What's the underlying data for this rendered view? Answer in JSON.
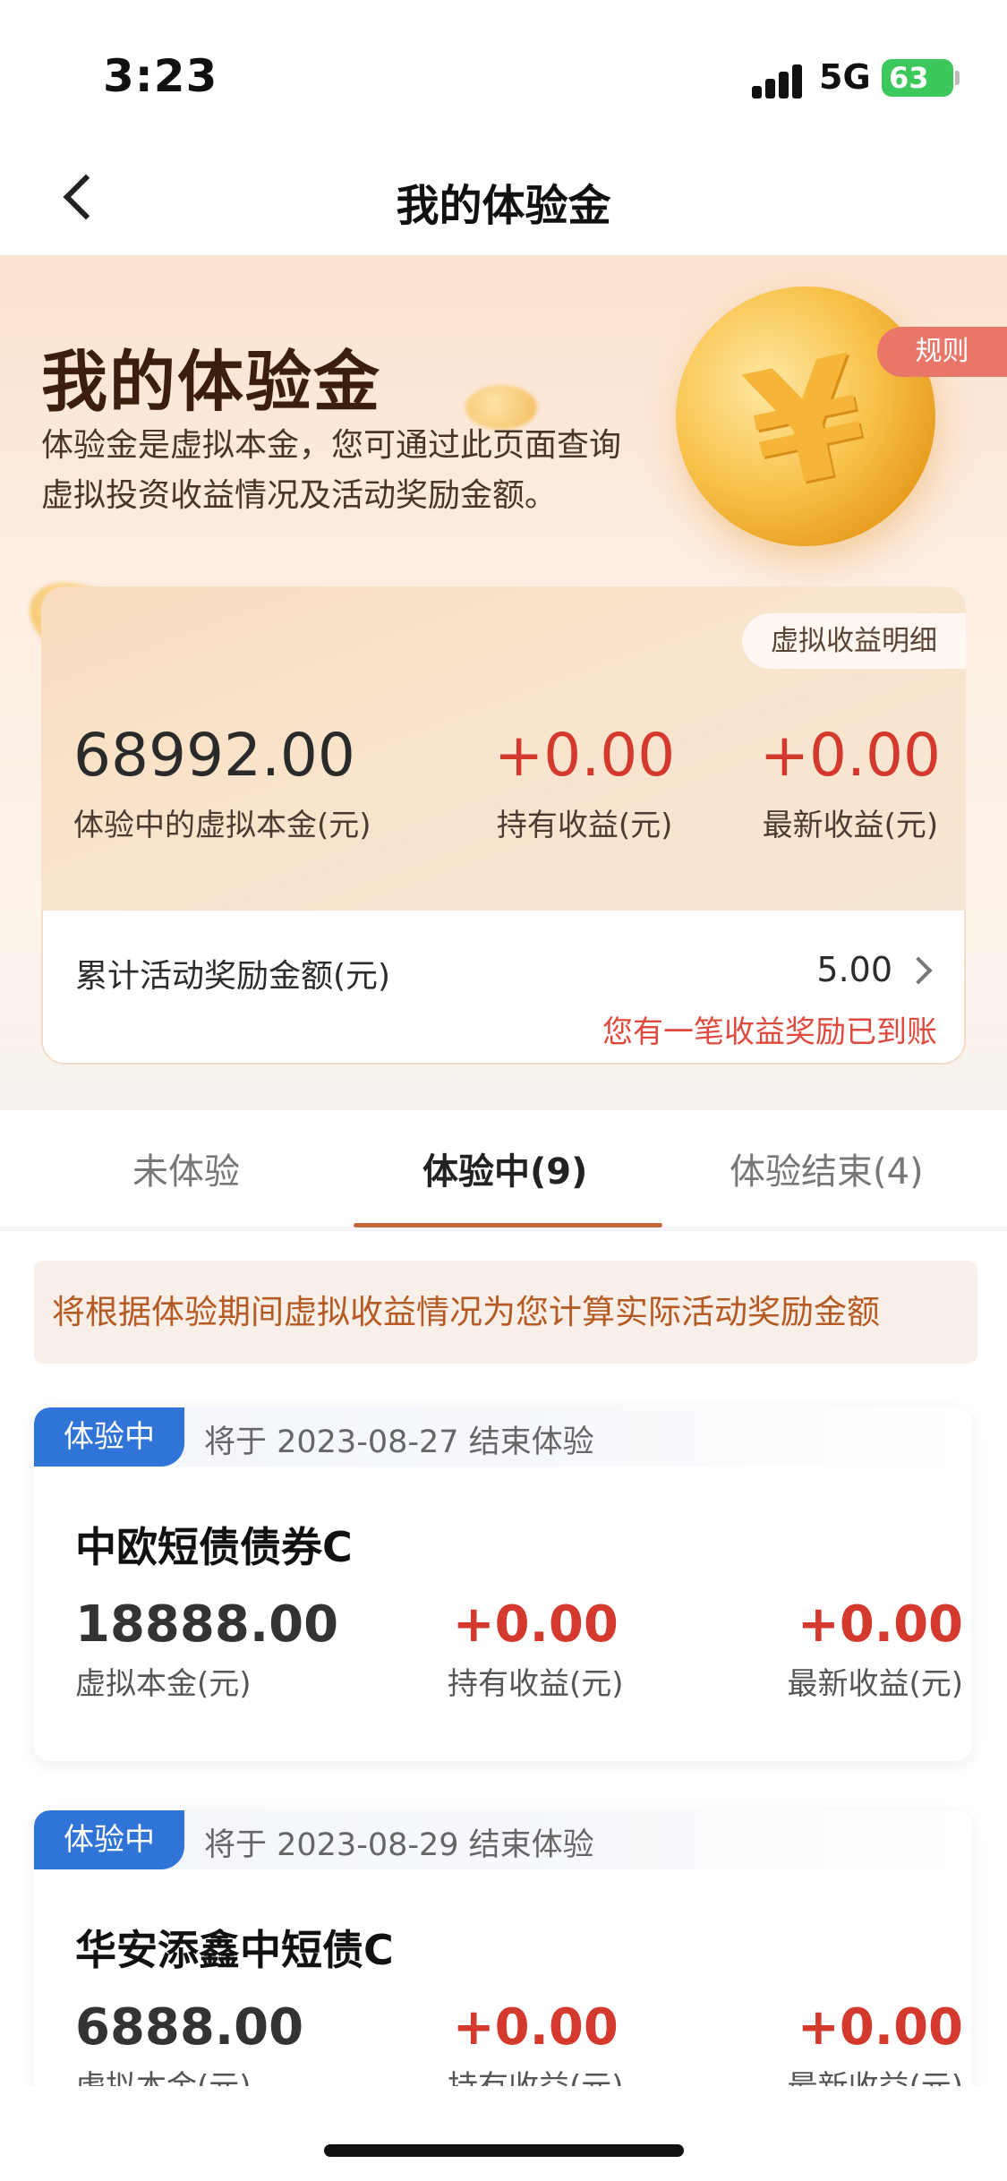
{
  "status_bar": {
    "time": "3:23",
    "network": "5G",
    "battery": "63"
  },
  "nav": {
    "title": "我的体验金"
  },
  "hero": {
    "title": "我的体验金",
    "description": "体验金是虚拟本金，您可通过此页面查询虚拟投资收益情况及活动奖励金额。",
    "rules_label": "规则"
  },
  "summary": {
    "detail_button": "虚拟收益明细",
    "principal": {
      "value": "68992.00",
      "label": "体验中的虚拟本金(元)"
    },
    "holding": {
      "value": "+0.00",
      "label": "持有收益(元)"
    },
    "latest": {
      "value": "+0.00",
      "label": "最新收益(元)"
    },
    "reward": {
      "label": "累计活动奖励金额(元)",
      "value": "5.00",
      "note": "您有一笔收益奖励已到账"
    }
  },
  "tabs": [
    {
      "label": "未体验"
    },
    {
      "label": "体验中(9)",
      "active": true
    },
    {
      "label": "体验结束(4)"
    }
  ],
  "notice": "将根据体验期间虚拟收益情况为您计算实际活动奖励金额",
  "funds": [
    {
      "badge": "体验中",
      "end_text": "将于 2023-08-27 结束体验",
      "name": "中欧短债债券C",
      "principal": "18888.00",
      "principal_label": "虚拟本金(元)",
      "holding": "+0.00",
      "holding_label": "持有收益(元)",
      "latest": "+0.00",
      "latest_label": "最新收益(元)"
    },
    {
      "badge": "体验中",
      "end_text": "将于 2023-08-29 结束体验",
      "name": "华安添鑫中短债C",
      "principal": "6888.00",
      "principal_label": "虚拟本金(元)",
      "holding": "+0.00",
      "holding_label": "持有收益(元)",
      "latest": "+0.00",
      "latest_label": "最新收益(元)"
    }
  ],
  "colors": {
    "accent": "#c3693d",
    "profit_red": "#d4392e",
    "badge_blue": "#2f74d6",
    "rule_btn": "#e8776a"
  },
  "icons": {
    "back": "chevron-left-icon",
    "reward_more": "chevron-right-icon",
    "coin": "yen-coin-icon"
  }
}
